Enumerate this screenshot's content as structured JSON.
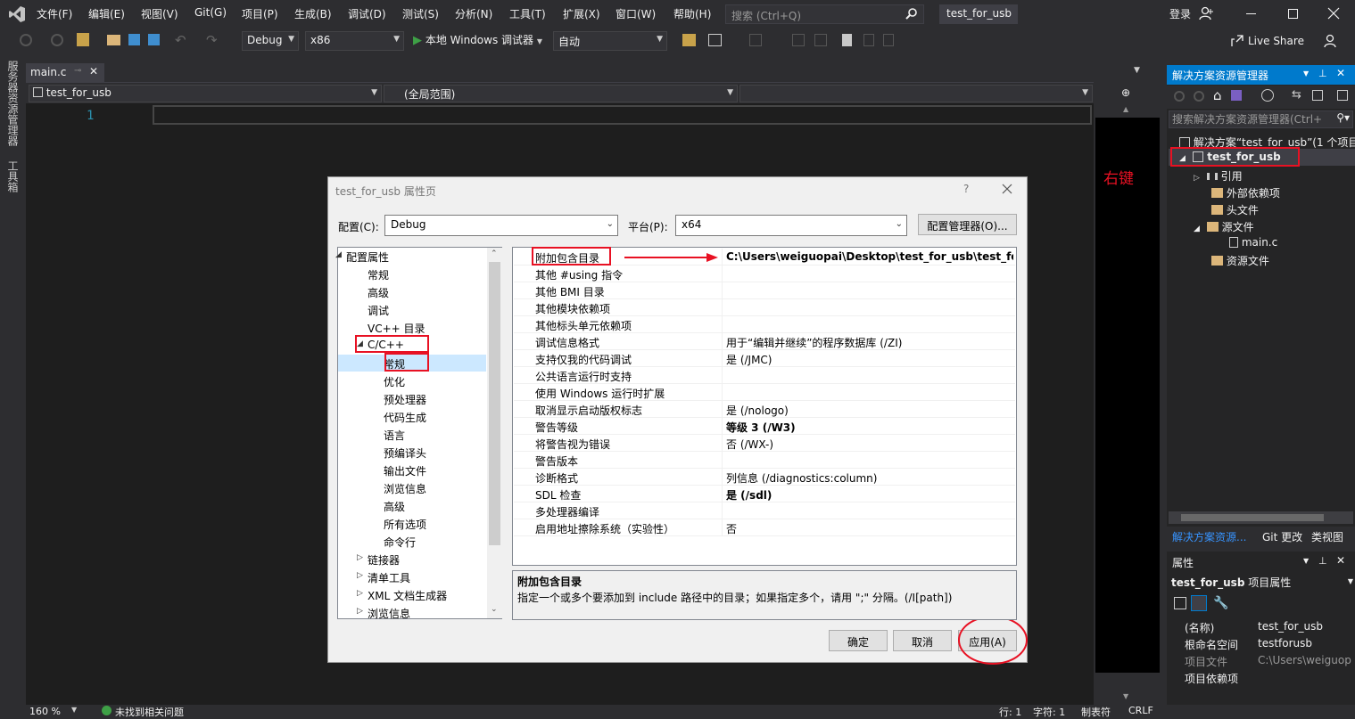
{
  "menu": {
    "items": [
      "文件(F)",
      "编辑(E)",
      "视图(V)",
      "Git(G)",
      "项目(P)",
      "生成(B)",
      "调试(D)",
      "测试(S)",
      "分析(N)",
      "工具(T)",
      "扩展(X)",
      "窗口(W)",
      "帮助(H)"
    ],
    "search_placeholder": "搜索 (Ctrl+Q)",
    "project_title": "test_for_usb",
    "login": "登录",
    "live_share": "Live Share"
  },
  "toolbar": {
    "config": "Debug",
    "platform": "x86",
    "run_label": "本地 Windows 调试器",
    "run_mode": "自动"
  },
  "left_strip": {
    "server_explorer": "服务器资源管理器",
    "toolbox": "工具箱"
  },
  "editor": {
    "tab_label": "main.c",
    "nav_project": "test_for_usb",
    "nav_scope": "(全局范围)",
    "line_number": "1",
    "annotation_right_click": "右键"
  },
  "solution_explorer": {
    "title": "解决方案资源管理器",
    "search_placeholder": "搜索解决方案资源管理器(Ctrl+",
    "solution": "解决方案“test_for_usb”(1 个项目",
    "project": "test_for_usb",
    "refs": "引用",
    "external_deps": "外部依赖项",
    "headers": "头文件",
    "sources": "源文件",
    "main_c": "main.c",
    "resources": "资源文件",
    "bottom_tabs": [
      "解决方案资源...",
      "Git 更改",
      "类视图"
    ]
  },
  "properties_panel": {
    "title": "属性",
    "header": "test_for_usb",
    "header_suffix": "项目属性",
    "rows": [
      {
        "name": "(名称)",
        "value": "test_for_usb"
      },
      {
        "name": "根命名空间",
        "value": "testforusb"
      },
      {
        "name": "项目文件",
        "value": "C:\\Users\\weiguop"
      },
      {
        "name": "项目依赖项",
        "value": ""
      }
    ]
  },
  "dialog": {
    "title": "test_for_usb 属性页",
    "help": "?",
    "config_label": "配置(C):",
    "config_value": "Debug",
    "platform_label": "平台(P):",
    "platform_value": "x64",
    "config_manager": "配置管理器(O)...",
    "tree": [
      {
        "label": "配置属性",
        "level": 0,
        "expander": "expanded"
      },
      {
        "label": "常规",
        "level": 1
      },
      {
        "label": "高级",
        "level": 1
      },
      {
        "label": "调试",
        "level": 1
      },
      {
        "label": "VC++ 目录",
        "level": 1
      },
      {
        "label": "C/C++",
        "level": 1,
        "expander": "expanded"
      },
      {
        "label": "常规",
        "level": 2,
        "selected": true
      },
      {
        "label": "优化",
        "level": 2
      },
      {
        "label": "预处理器",
        "level": 2
      },
      {
        "label": "代码生成",
        "level": 2
      },
      {
        "label": "语言",
        "level": 2
      },
      {
        "label": "预编译头",
        "level": 2
      },
      {
        "label": "输出文件",
        "level": 2
      },
      {
        "label": "浏览信息",
        "level": 2
      },
      {
        "label": "高级",
        "level": 2
      },
      {
        "label": "所有选项",
        "level": 2
      },
      {
        "label": "命令行",
        "level": 2
      },
      {
        "label": "链接器",
        "level": 1,
        "expander": "collapsed"
      },
      {
        "label": "清单工具",
        "level": 1,
        "expander": "collapsed"
      },
      {
        "label": "XML 文档生成器",
        "level": 1,
        "expander": "collapsed"
      },
      {
        "label": "浏览信息",
        "level": 1,
        "expander": "collapsed"
      }
    ],
    "grid": [
      {
        "name": "附加包含目录",
        "value": "C:\\Users\\weiguopai\\Desktop\\test_for_usb\\test_for_us",
        "bold": true
      },
      {
        "name": "其他 #using 指令",
        "value": ""
      },
      {
        "name": "其他 BMI 目录",
        "value": ""
      },
      {
        "name": "其他模块依赖项",
        "value": ""
      },
      {
        "name": "其他标头单元依赖项",
        "value": ""
      },
      {
        "name": "调试信息格式",
        "value": "用于“编辑并继续”的程序数据库 (/ZI)"
      },
      {
        "name": "支持仅我的代码调试",
        "value": "是 (/JMC)"
      },
      {
        "name": "公共语言运行时支持",
        "value": ""
      },
      {
        "name": "使用 Windows 运行时扩展",
        "value": ""
      },
      {
        "name": "取消显示启动版权标志",
        "value": "是 (/nologo)"
      },
      {
        "name": "警告等级",
        "value": "等级 3 (/W3)",
        "bold": true
      },
      {
        "name": "将警告视为错误",
        "value": "否 (/WX-)"
      },
      {
        "name": "警告版本",
        "value": ""
      },
      {
        "name": "诊断格式",
        "value": "列信息 (/diagnostics:column)"
      },
      {
        "name": "SDL 检查",
        "value": "是 (/sdl)",
        "bold": true
      },
      {
        "name": "多处理器编译",
        "value": ""
      },
      {
        "name": "启用地址擦除系统（实验性）",
        "value": "否"
      }
    ],
    "desc_title": "附加包含目录",
    "desc_text": "指定一个或多个要添加到 include 路径中的目录；如果指定多个，请用 \";\" 分隔。(/I[path])",
    "ok": "确定",
    "cancel": "取消",
    "apply": "应用(A)"
  },
  "status": {
    "zoom": "160 %",
    "issues": "未找到相关问题",
    "line": "行: 1",
    "col": "字符: 1",
    "tab": "制表符",
    "eol": "CRLF"
  },
  "colors": {
    "accent": "#007acc",
    "highlight_red": "#e81123",
    "arrow_red": "#e81123"
  }
}
